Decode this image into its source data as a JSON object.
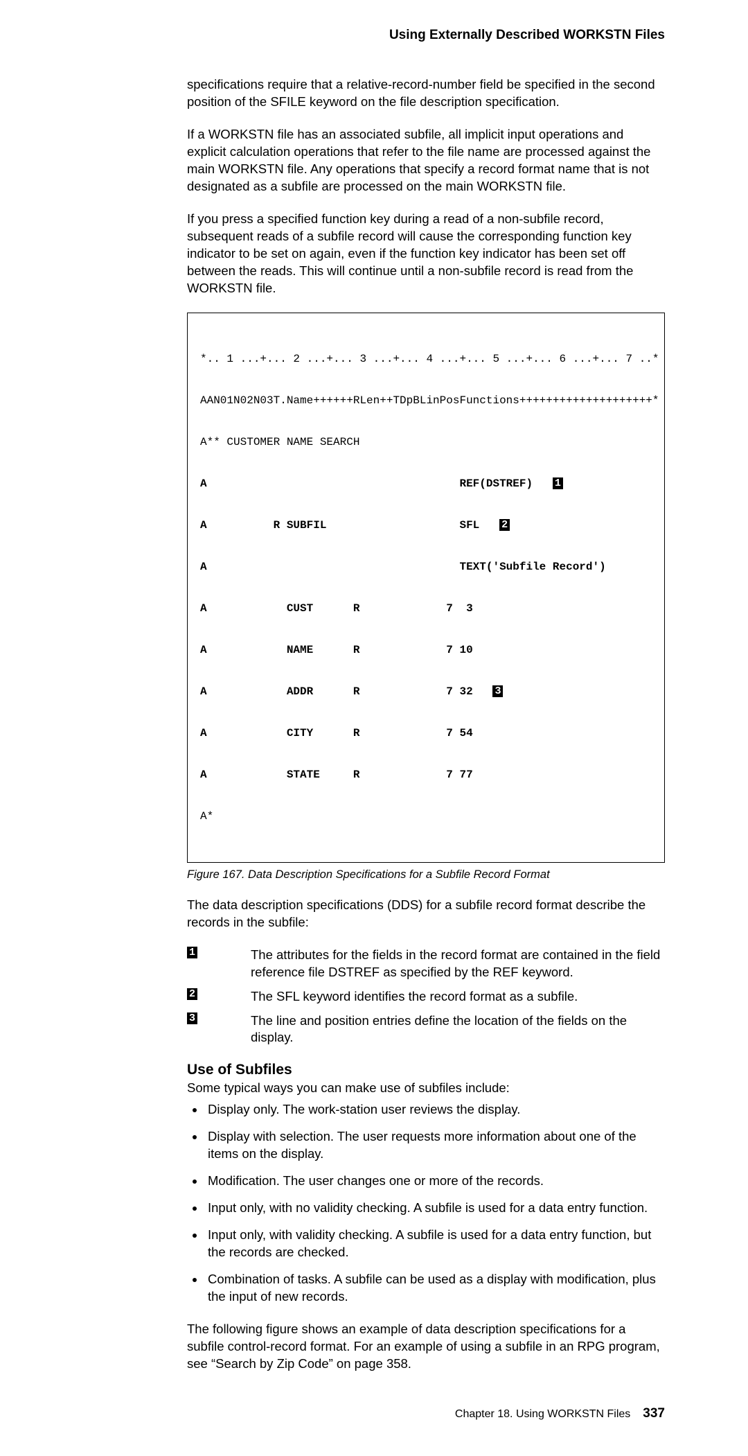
{
  "running_head": "Using Externally Described WORKSTN Files",
  "para1": "specifications require that a relative-record-number field be specified in the second position of the SFILE keyword on the file description specification.",
  "para2": "If a WORKSTN file has an associated subfile, all implicit input operations and explicit calculation operations that refer to the file name are processed against the main WORKSTN file. Any operations that specify a record format name that is not designated as a subfile are processed on the main WORKSTN file.",
  "para3": "If you press a specified function key during a read of a non-subfile record, subsequent reads of a subfile record will cause the corresponding function key indicator to be set on again, even if the function key indicator has been set off between the reads. This will continue until a non-subfile record is read from the WORKSTN file.",
  "code": {
    "l1": "*.. 1 ...+... 2 ...+... 3 ...+... 4 ...+... 5 ...+... 6 ...+... 7 ..*",
    "l2": "AAN01N02N03T.Name++++++RLen++TDpBLinPosFunctions++++++++++++++++++++*",
    "l3": "A** CUSTOMER NAME SEARCH",
    "l4a": "A                                      REF(DSTREF)   ",
    "l5a": "A          R SUBFIL                    SFL   ",
    "l6": "A                                      TEXT('Subfile Record')",
    "l7": "A            CUST      R             7  3",
    "l8": "A            NAME      R             7 10",
    "l9a": "A            ADDR      R             7 32   ",
    "l10": "A            CITY      R             7 54",
    "l11": "A            STATE     R             7 77",
    "l12": "A*",
    "co1": "1",
    "co2": "2",
    "co3": "3"
  },
  "fig_caption": "Figure  167. Data Description Specifications for a Subfile Record Format",
  "para4": "The data description specifications (DDS) for a subfile record format describe the records in the subfile:",
  "notes": {
    "n1_num": "1",
    "n1_text": "The attributes for the fields in the record format are contained in the field reference file DSTREF as specified by the REF keyword.",
    "n2_num": "2",
    "n2_text": "The SFL keyword identifies the record format as a subfile.",
    "n3_num": "3",
    "n3_text": "The line and position entries define the location of the fields on the display."
  },
  "use_heading": "Use of Subfiles",
  "para5": "Some typical ways you can make use of subfiles include:",
  "bullets": {
    "b1": "Display only. The work-station user reviews the display.",
    "b2": "Display with selection. The user requests more information about one of the items on the display.",
    "b3": "Modification. The user changes one or more of the records.",
    "b4": "Input only, with no validity checking. A subfile is used for a data entry function.",
    "b5": "Input only, with validity checking. A subfile is used for a data entry function, but the records are checked.",
    "b6": "Combination of tasks. A subfile can be used as a display with modification, plus the input of new records."
  },
  "para6": "The following figure shows an example of data description specifications for a subfile control-record format. For an example of using a subfile in an RPG program, see “Search by Zip Code” on page  358.",
  "footer": {
    "chapter": "Chapter 18.  Using WORKSTN Files",
    "page": "337"
  }
}
